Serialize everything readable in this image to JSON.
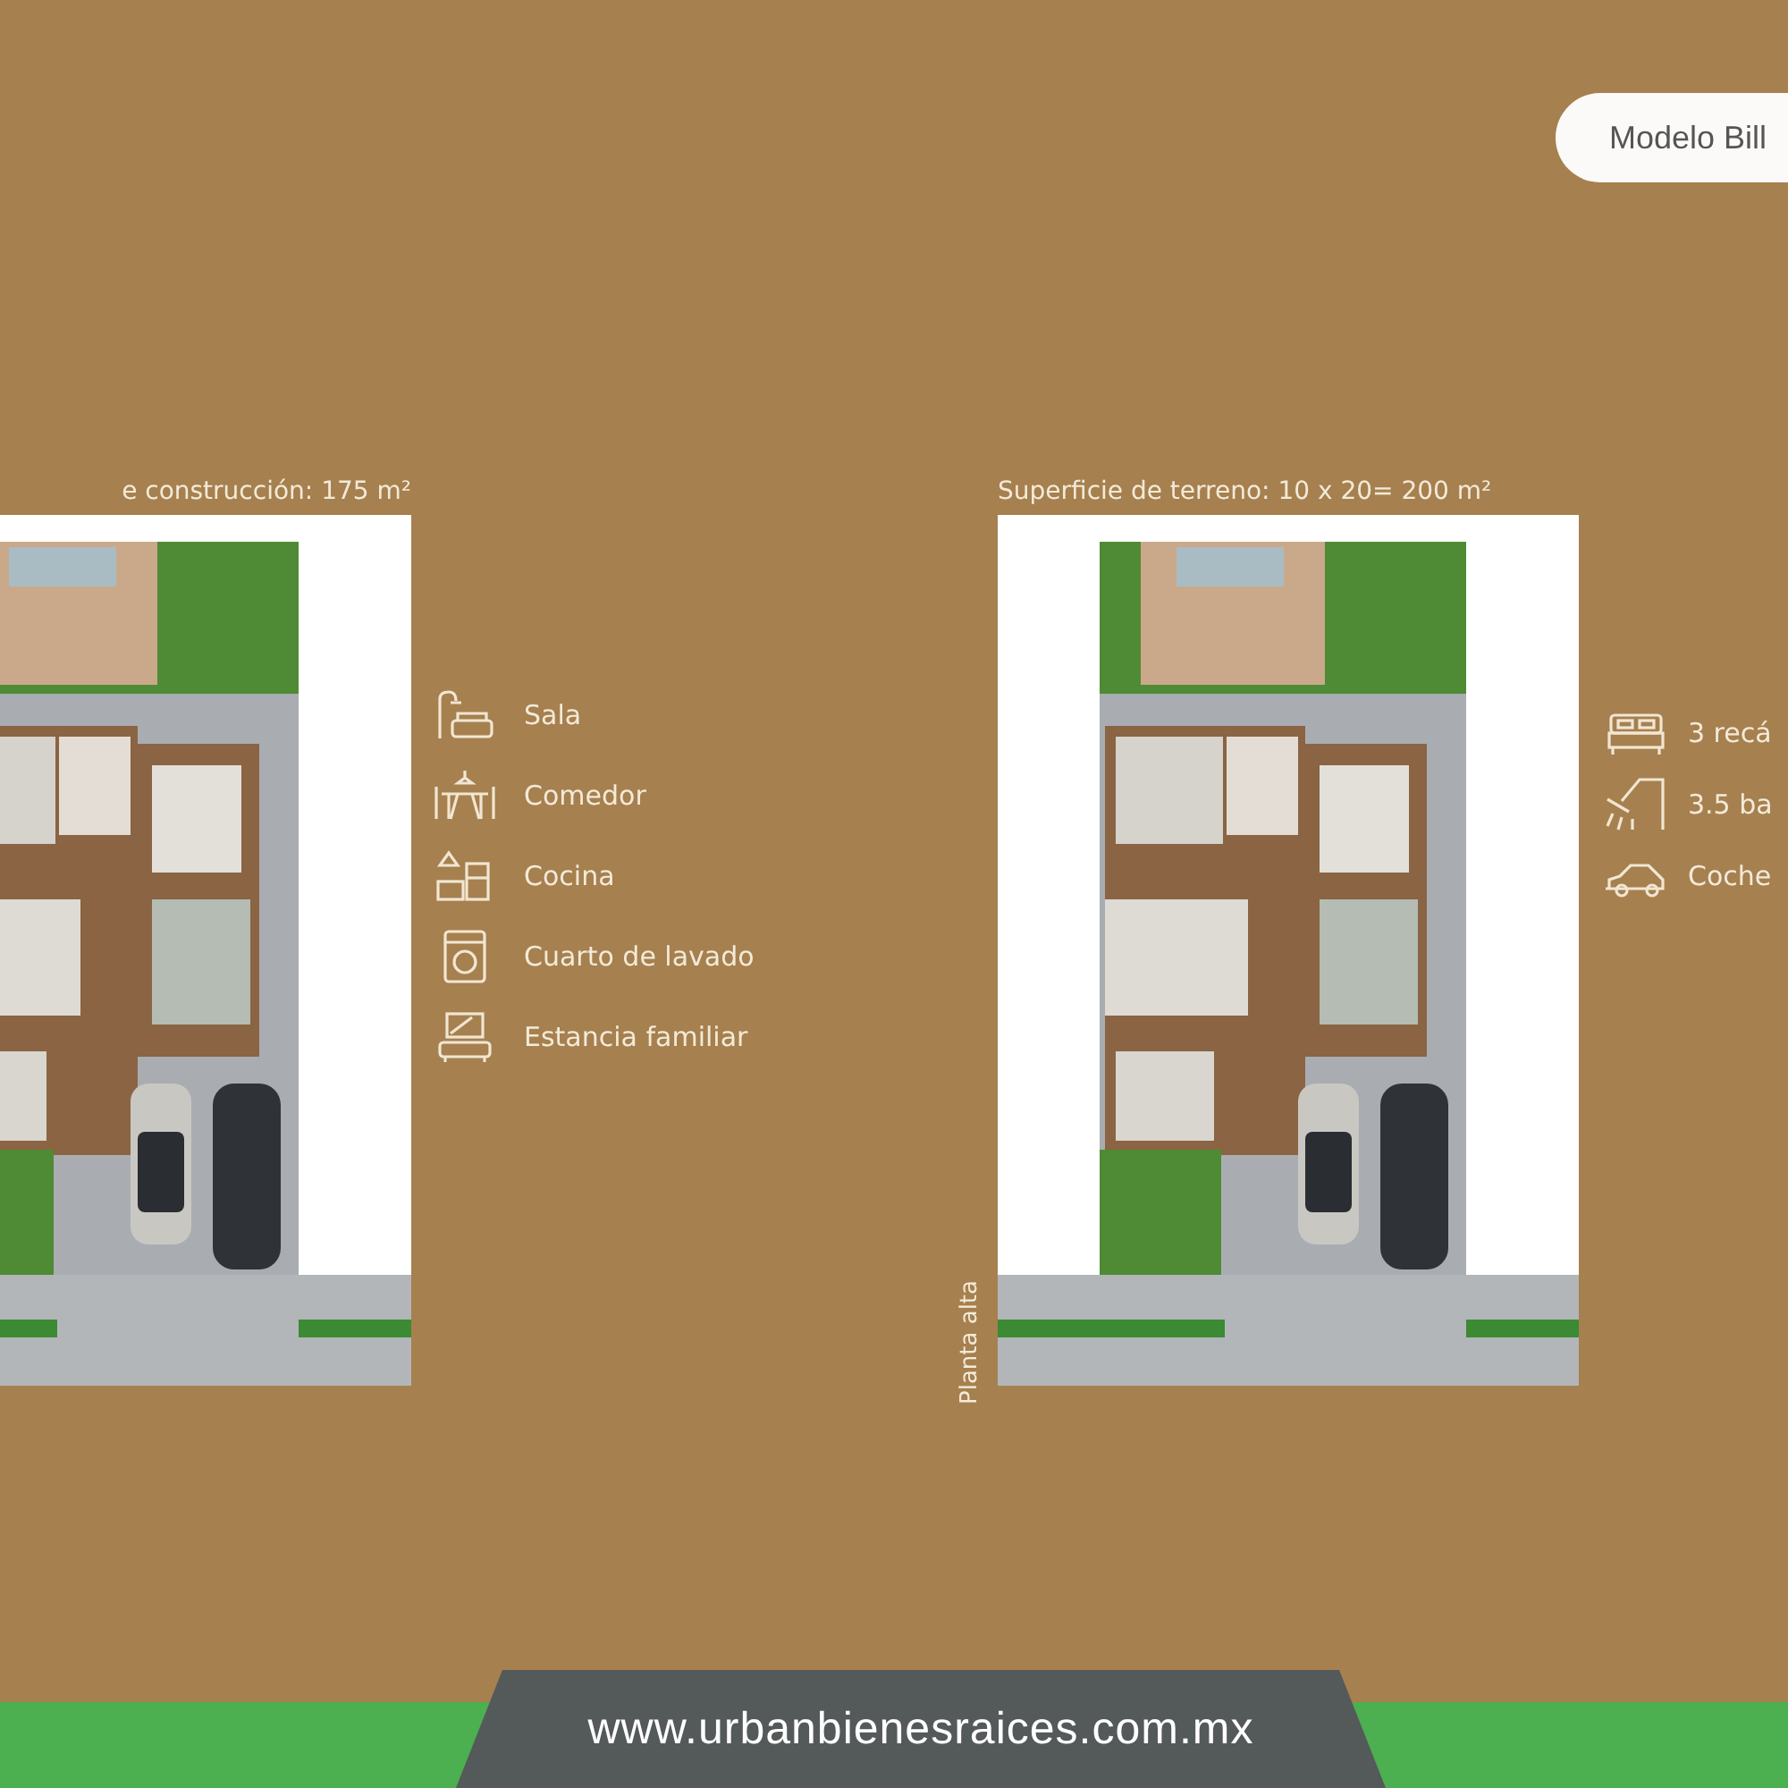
{
  "badge": {
    "label": "Modelo Bill"
  },
  "plans": [
    {
      "caption": "e construcción: 175 m²",
      "features": [
        {
          "kind": "sofa",
          "label": "Sala"
        },
        {
          "kind": "dining",
          "label": "Comedor"
        },
        {
          "kind": "kitchen",
          "label": "Cocina"
        },
        {
          "kind": "washer",
          "label": "Cuarto de lavado"
        },
        {
          "kind": "tv",
          "label": "Estancia familiar"
        }
      ]
    },
    {
      "caption": "Superficie de terreno: 10 x 20= 200 m²",
      "side_label": "Planta alta",
      "features": [
        {
          "kind": "bed",
          "label": "3 recá"
        },
        {
          "kind": "shower",
          "label": "3.5 ba"
        },
        {
          "kind": "car",
          "label": "Coche"
        }
      ]
    }
  ],
  "footer": {
    "url": "www.urbanbienesraices.com.mx"
  }
}
